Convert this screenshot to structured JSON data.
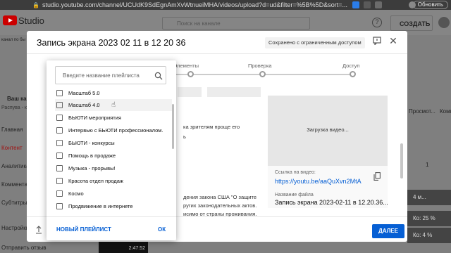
{
  "browser": {
    "url": "studio.youtube.com/channel/UCUdK9SdEgnAmXvWtnueiMHA/videos/upload?d=ud&filter=%5B%5D&sort=...",
    "update_label": "Обновить"
  },
  "studio": {
    "logo_text": "Studio",
    "search_placeholder": "Поиск на канале",
    "create_label": "СОЗДАТЬ",
    "sidebar": [
      "Ваш кан",
      "Распува - к",
      "Главная",
      "Контент",
      "Аналитика",
      "Коммента",
      "Субтитры",
      "Настройки",
      "Отправить отзыв"
    ],
    "right_columns": [
      "Просмот...",
      "Комм"
    ],
    "right_value": "1",
    "channel_badge": "канал по бы",
    "thumb_duration": "2:47:52",
    "pills": [
      "4 м...",
      "Ко: 25 %",
      "Ко: 4 %"
    ]
  },
  "dialog": {
    "title": "Запись экрана 2023 02 11 в 12 20 36",
    "status": "Сохранено с ограниченным доступом",
    "steps": [
      "Элементы",
      "Проверка",
      "Доступ"
    ],
    "bg_text_1": "ка зрителям проще его",
    "bg_text_2": "ь",
    "bg_text_3": "дения закона США \"О защите",
    "bg_text_4": "ругих законодательных актов.",
    "bg_text_5": "исимо от страны проживания.",
    "preview_text": "Загрузка видео...",
    "link_label": "Ссылка на видео:",
    "link_url": "https://youtu.be/aaQuXvn2MtA",
    "filename_label": "Название файла",
    "filename": "Запись экрана 2023-02-11 в 12.20.36...",
    "next_label": "ДАЛЕЕ"
  },
  "playlist_popup": {
    "search_placeholder": "Введите название плейлиста",
    "items": [
      {
        "label": "Масштаб 5.0",
        "checked": false
      },
      {
        "label": "Масштаб 4.0",
        "checked": false
      },
      {
        "label": "БЬЮТИ мероприятия",
        "checked": false
      },
      {
        "label": "Интервью с БЬЮТИ профессионалом.",
        "checked": false
      },
      {
        "label": "БЬЮТИ - конкурсы",
        "checked": false
      },
      {
        "label": "Помощь в продаже",
        "checked": false
      },
      {
        "label": "Музыка - прорывы!",
        "checked": false
      },
      {
        "label": "Красота отдел продаж",
        "checked": false
      },
      {
        "label": "Космо",
        "checked": false
      },
      {
        "label": "Продвижение в интернете",
        "checked": false
      }
    ],
    "new_playlist_label": "НОВЫЙ ПЛЕЙЛИСТ",
    "ok_label": "ОК"
  }
}
